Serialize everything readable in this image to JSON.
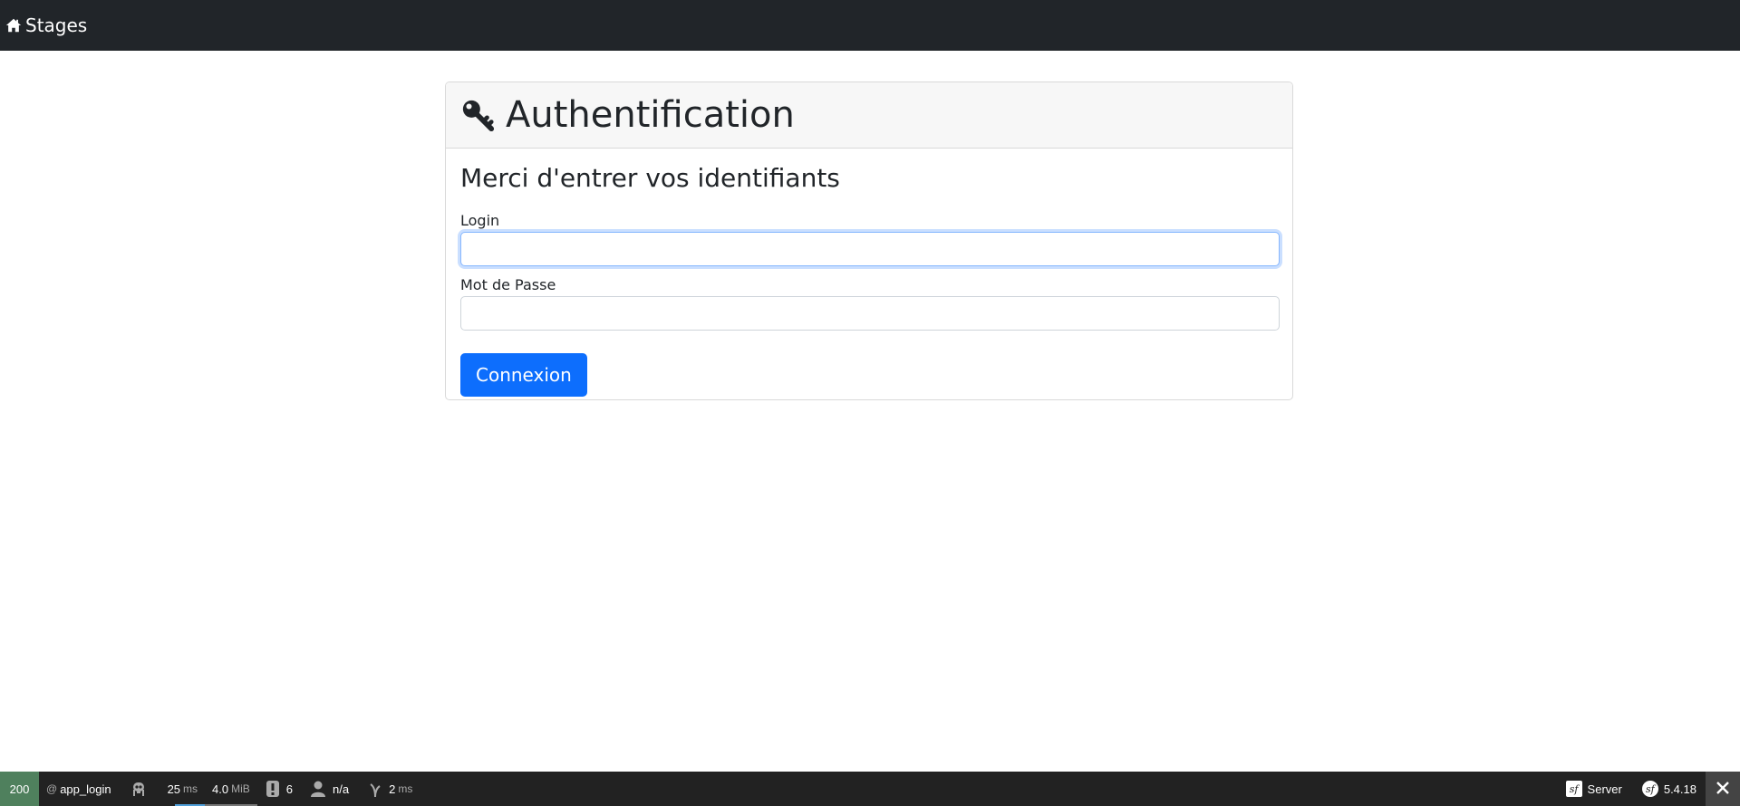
{
  "navbar": {
    "brand_label": "Stages",
    "brand_icon": "home-icon"
  },
  "card": {
    "title": "Authentification",
    "title_icon": "key-icon",
    "subtitle": "Merci d'entrer vos identifiants",
    "login_label": "Login",
    "login_value": "",
    "password_label": "Mot de Passe",
    "password_value": "",
    "submit_label": "Connexion"
  },
  "toolbar": {
    "status_code": "200",
    "route": "app_login",
    "route_prefix": "@",
    "time_value": "25",
    "time_unit": "ms",
    "memory_value": "4.0",
    "memory_unit": "MiB",
    "logs_count": "6",
    "user": "n/a",
    "twig_value": "2",
    "twig_unit": "ms",
    "server_label": "Server",
    "version": "5.4.18",
    "colors": {
      "status_ok": "#4f805d",
      "background": "#222222",
      "time_bar": "#4f9fd9",
      "memory_bar": "#777777"
    }
  },
  "colors": {
    "navbar": "#212529",
    "primary": "#0d6efd",
    "card_header": "#f7f7f7"
  }
}
